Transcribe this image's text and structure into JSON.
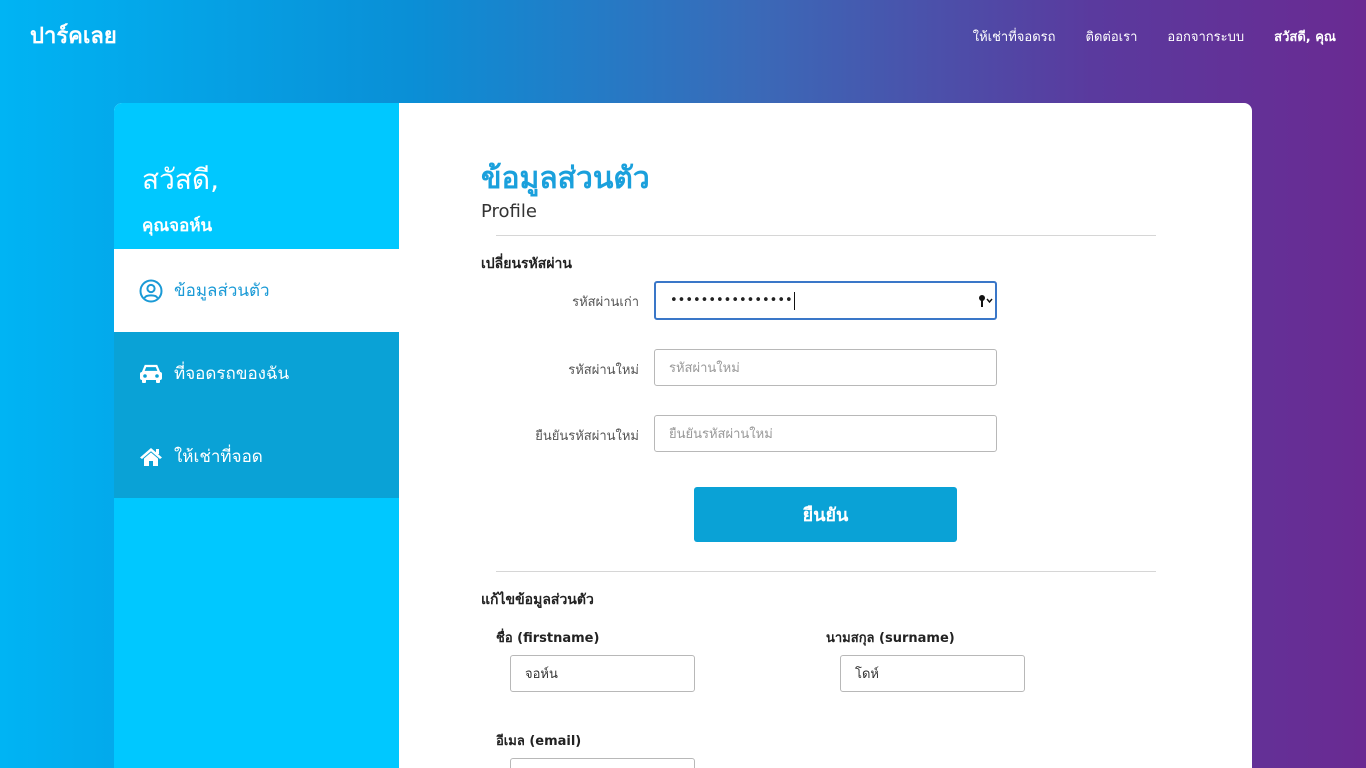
{
  "header": {
    "brand": "ปาร์คเลย",
    "nav": [
      {
        "label": "ให้เช่าที่จอดรถ"
      },
      {
        "label": "ติดต่อเรา"
      },
      {
        "label": "ออกจากระบบ"
      },
      {
        "label": "สวัสดี, คุณ"
      }
    ]
  },
  "sidebar": {
    "greeting": "สวัสดี,",
    "name": "คุณจอห์น",
    "items": [
      {
        "label": "ข้อมูลส่วนตัว",
        "icon": "user-circle-icon",
        "active": true
      },
      {
        "label": "ที่จอดรถของฉัน",
        "icon": "car-icon",
        "active": false
      },
      {
        "label": "ให้เช่าที่จอด",
        "icon": "home-icon",
        "active": false
      }
    ]
  },
  "main": {
    "title": "ข้อมูลส่วนตัว",
    "subtitle": "Profile",
    "password_section": {
      "heading": "เปลี่ยนรหัสผ่าน",
      "old_label": "รหัสผ่านเก่า",
      "old_value": "••••••••••••••••",
      "new_label": "รหัสผ่านใหม่",
      "new_placeholder": "รหัสผ่านใหม่",
      "confirm_label": "ยืนยันรหัสผ่านใหม่",
      "confirm_placeholder": "ยืนยันรหัสผ่านใหม่",
      "submit": "ยืนยัน"
    },
    "profile_section": {
      "heading": "แก้ไขข้อมูลส่วนตัว",
      "firstname_label": "ชื่อ (firstname)",
      "firstname_value": "จอห์น",
      "surname_label": "นามสกุล (surname)",
      "surname_value": "โดห์",
      "email_label": "อีเมล (email)"
    }
  },
  "colors": {
    "accent": "#1aa0dc",
    "sidebar": "#00c8ff",
    "button": "#0aa2d6"
  }
}
